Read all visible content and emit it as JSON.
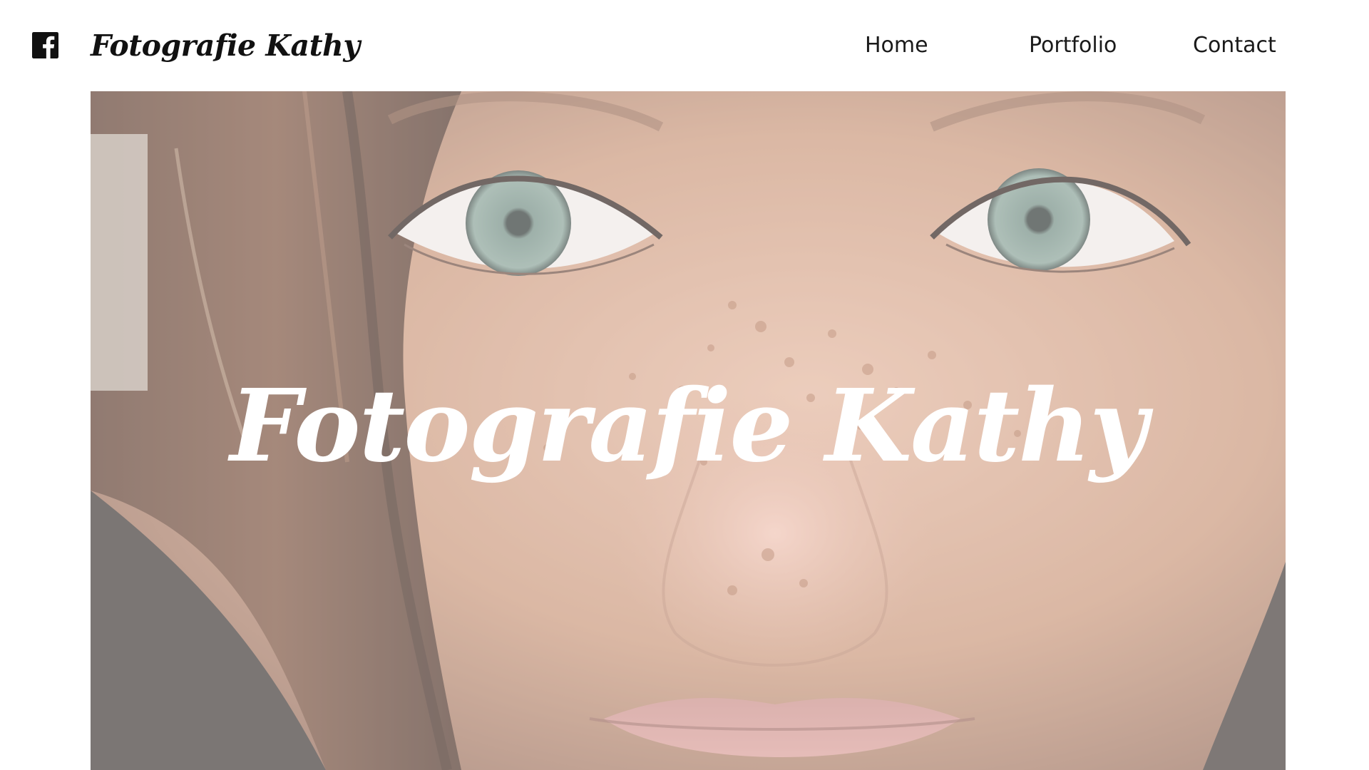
{
  "header": {
    "facebook_icon": "facebook-icon",
    "brand": "Fotografie Kathy",
    "nav": [
      {
        "label": "Home"
      },
      {
        "label": "Portfolio"
      },
      {
        "label": "Contact"
      }
    ]
  },
  "hero": {
    "title": "Fotografie Kathy",
    "image_subject": "close-up portrait of a freckled face with green eyes"
  },
  "colors": {
    "background": "#ffffff",
    "text": "#111111",
    "hero_title": "#ffffff"
  }
}
